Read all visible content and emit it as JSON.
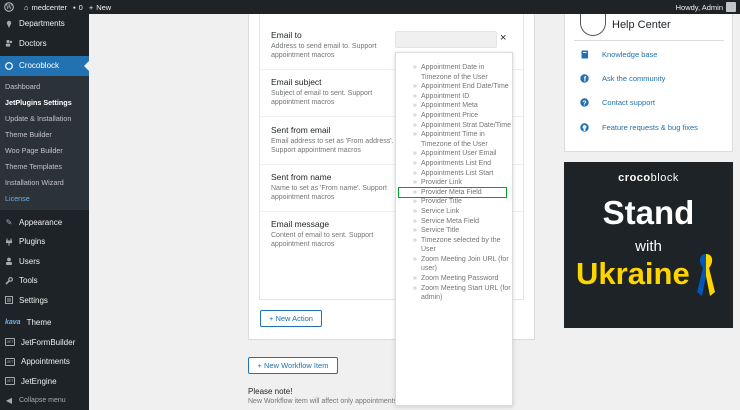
{
  "adminbar": {
    "site_name": "medcenter",
    "comments_count": "0",
    "new_label": "New",
    "howdy": "Howdy, Admin"
  },
  "sidebar": {
    "top_items": [
      {
        "label": "Departments",
        "icon": "pin-icon"
      },
      {
        "label": "Doctors",
        "icon": "users-icon"
      }
    ],
    "active_item": {
      "label": "Crocoblock",
      "icon": "croco-icon"
    },
    "submenu": [
      "Dashboard",
      "JetPlugins Settings",
      "Update & Installation",
      "Theme Builder",
      "Woo Page Builder",
      "Theme Templates",
      "Installation Wizard",
      "License"
    ],
    "bottom_items": [
      {
        "label": "Appearance",
        "icon": "brush-icon"
      },
      {
        "label": "Plugins",
        "icon": "plug-icon"
      },
      {
        "label": "Users",
        "icon": "user-icon"
      },
      {
        "label": "Tools",
        "icon": "wrench-icon"
      },
      {
        "label": "Settings",
        "icon": "settings-icon"
      }
    ],
    "kava_prefix": "kava",
    "kava_label": "Theme",
    "jet_badge": "JET",
    "jet_items": [
      "JetFormBuilder",
      "Appointments",
      "JetEngine"
    ],
    "collapse_label": "Collapse menu"
  },
  "form": {
    "fields": [
      {
        "title": "Email to",
        "desc": "Address to send email to. Support appointment macros"
      },
      {
        "title": "Email subject",
        "desc": "Subject of email to sent. Support appointment macros"
      },
      {
        "title": "Sent from email",
        "desc": "Email address to set as 'From address'. Support appointment macros"
      },
      {
        "title": "Sent from name",
        "desc": "Name to set as 'From name'. Support appointment macros"
      },
      {
        "title": "Email message",
        "desc": "Content of email to sent. Support appointment macros"
      }
    ],
    "close_label": "×",
    "new_action_label": "+ New Action",
    "new_workflow_label": "+ New Workflow Item",
    "note_title": "Please note!",
    "note_text": "New Workflow item will affect only appointments"
  },
  "macros": {
    "items": [
      "Appointment Date in Timezone of the User",
      "Appointment End Date/Time",
      "Appointment ID",
      "Appointment Meta",
      "Appointment Price",
      "Appointment Strat Date/Time",
      "Appointment Time in Timezone of the User",
      "Appointment User Email",
      "Appointments List End",
      "Appointments List Start",
      "Provider Link",
      "Provider Meta Field",
      "Provider Title",
      "Service Link",
      "Service Meta Field",
      "Service Title",
      "Timezone selected by the User",
      "Zoom Meeting Join URL (for user)",
      "Zoom Meeting Password",
      "Zoom Meeting Start URL (for admin)"
    ],
    "selected": "Provider Meta Field",
    "selected_color": "#00a32a"
  },
  "help": {
    "title": "Help Center",
    "links": [
      {
        "label": "Knowledge base",
        "icon": "book-icon"
      },
      {
        "label": "Ask the community",
        "icon": "facebook-icon"
      },
      {
        "label": "Contact support",
        "icon": "question-icon"
      },
      {
        "label": "Feature requests & bug fixes",
        "icon": "github-icon"
      }
    ]
  },
  "banner": {
    "brand_bold": "croco",
    "brand_light": "block",
    "line1": "Stand",
    "line2": "with",
    "line3": "Ukraine",
    "blue": "#0057b7",
    "yellow": "#ffd500"
  },
  "colors": {
    "wp_dark": "#1d2327",
    "wp_blue": "#2271b1"
  }
}
